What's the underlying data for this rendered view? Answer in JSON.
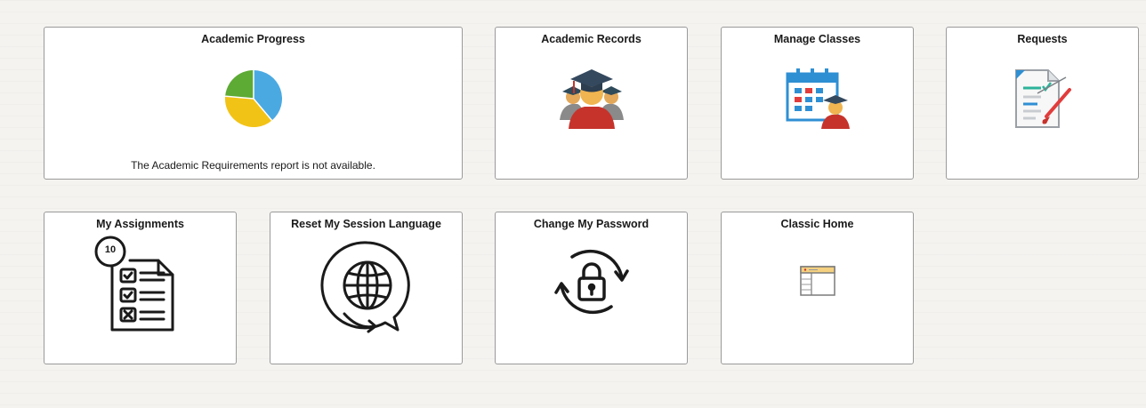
{
  "tiles": {
    "academic_progress": {
      "title": "Academic Progress",
      "message": "The Academic Requirements report is not available.",
      "pie_colors": [
        "#4ba9e2",
        "#f2c317",
        "#5daa34"
      ]
    },
    "academic_records": {
      "title": "Academic Records"
    },
    "manage_classes": {
      "title": "Manage Classes"
    },
    "requests": {
      "title": "Requests"
    },
    "my_assignments": {
      "title": "My Assignments",
      "badge": "10"
    },
    "reset_language": {
      "title": "Reset My Session Language"
    },
    "change_password": {
      "title": "Change My Password"
    },
    "classic_home": {
      "title": "Classic Home"
    }
  },
  "icons": {
    "academic_progress": "pie-chart-icon",
    "academic_records": "graduates-icon",
    "manage_classes": "calendar-student-icon",
    "requests": "document-edit-icon",
    "my_assignments": "checklist-icon",
    "reset_language": "globe-speech-icon",
    "change_password": "lock-refresh-icon",
    "classic_home": "classic-home-icon"
  },
  "colors": {
    "background": "#f4f3f0",
    "tile_background": "#ffffff",
    "tile_border": "#9a9a9a"
  }
}
